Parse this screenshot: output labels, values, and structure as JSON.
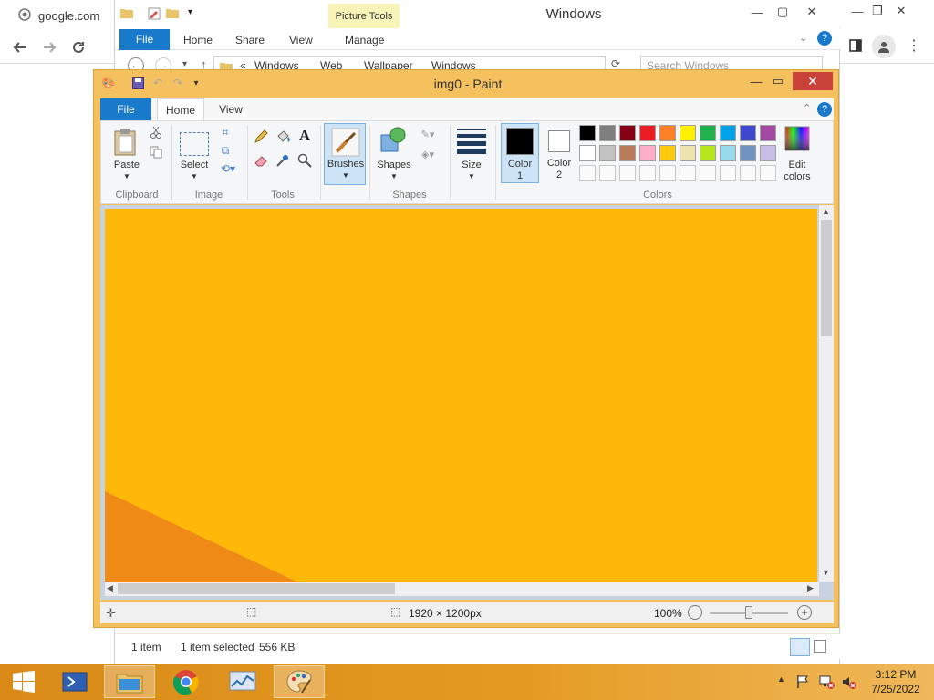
{
  "chrome": {
    "tab_title": "google.com"
  },
  "explorer": {
    "title": "Windows",
    "context_tab": "Picture Tools",
    "tabs": [
      "File",
      "Home",
      "Share",
      "View",
      "Manage"
    ],
    "breadcrumb": [
      "«",
      "Windows",
      "Web",
      "Wallpaper",
      "Windows"
    ],
    "search_placeholder": "Search Windows",
    "status": {
      "items": "1 item",
      "selected": "1 item selected",
      "size": "556 KB"
    }
  },
  "paint": {
    "title": "img0 - Paint",
    "tabs": {
      "file": "File",
      "home": "Home",
      "view": "View"
    },
    "groups": {
      "clipboard": "Clipboard",
      "image": "Image",
      "tools": "Tools",
      "shapes": "Shapes",
      "colors": "Colors"
    },
    "buttons": {
      "paste": "Paste",
      "select": "Select",
      "brushes": "Brushes",
      "shapes": "Shapes",
      "size": "Size",
      "color1_line1": "Color",
      "color1_line2": "1",
      "color2_line1": "Color",
      "color2_line2": "2",
      "edit_colors_line1": "Edit",
      "edit_colors_line2": "colors"
    },
    "color1": "#000000",
    "color2": "#ffffff",
    "palette_row1": [
      "#000000",
      "#7f7f7f",
      "#880015",
      "#ed1c24",
      "#ff7f27",
      "#fff200",
      "#22b14c",
      "#00a2e8",
      "#3f48cc",
      "#a349a4"
    ],
    "palette_row2": [
      "#ffffff",
      "#c3c3c3",
      "#b97a57",
      "#ffaec9",
      "#ffc90e",
      "#efe4b0",
      "#b5e61d",
      "#99d9ea",
      "#7092be",
      "#c8bfe7"
    ],
    "canvas_colors": {
      "main": "#feb80a",
      "corner": "#f08a16"
    },
    "status": {
      "dimensions": "1920 × 1200px",
      "zoom": "100%"
    }
  },
  "taskbar": {
    "clock_time": "3:12 PM",
    "clock_date": "7/25/2022"
  }
}
